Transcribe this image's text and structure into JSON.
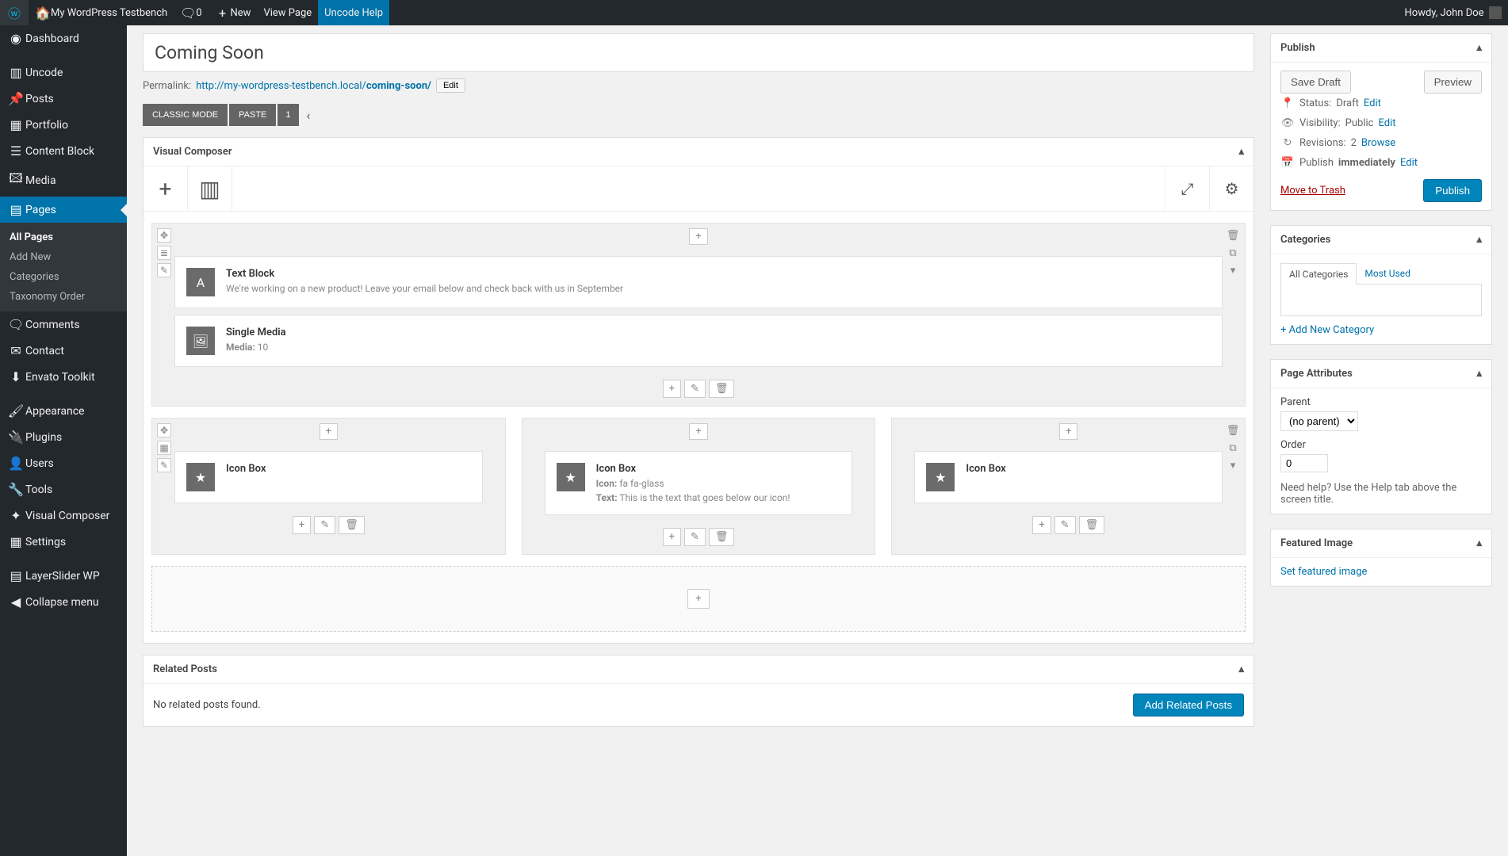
{
  "adminbar": {
    "site_name": "My WordPress Testbench",
    "comments_count": "0",
    "new_label": "New",
    "view_page": "View Page",
    "uncode_help": "Uncode Help",
    "howdy": "Howdy, John Doe"
  },
  "sidebar": {
    "items": [
      {
        "label": "Dashboard",
        "icon": "◐"
      },
      {
        "label": "Uncode",
        "icon": "▥"
      },
      {
        "label": "Posts",
        "icon": "✎"
      },
      {
        "label": "Portfolio",
        "icon": "▦"
      },
      {
        "label": "Content Block",
        "icon": "☰"
      },
      {
        "label": "Media",
        "icon": "🖾"
      },
      {
        "label": "Pages",
        "icon": "▤",
        "current": true
      },
      {
        "label": "Comments",
        "icon": "🗨"
      },
      {
        "label": "Contact",
        "icon": "✉"
      },
      {
        "label": "Envato Toolkit",
        "icon": "⬇"
      },
      {
        "label": "Appearance",
        "icon": "🖌"
      },
      {
        "label": "Plugins",
        "icon": "🔌"
      },
      {
        "label": "Users",
        "icon": "👤"
      },
      {
        "label": "Tools",
        "icon": "🔧"
      },
      {
        "label": "Visual Composer",
        "icon": "✦"
      },
      {
        "label": "Settings",
        "icon": "▦"
      },
      {
        "label": "LayerSlider WP",
        "icon": "▤"
      },
      {
        "label": "Collapse menu",
        "icon": "◀"
      }
    ],
    "pages_submenu": [
      "All Pages",
      "Add New",
      "Categories",
      "Taxonomy Order"
    ]
  },
  "page": {
    "title": "Coming Soon",
    "permalink_label": "Permalink:",
    "permalink_base": "http://my-wordpress-testbench.local/",
    "permalink_slug": "coming-soon/",
    "edit_btn": "Edit",
    "classic_mode": "CLASSIC MODE",
    "paste": "PASTE",
    "one": "1"
  },
  "vc": {
    "title": "Visual Composer",
    "text_block": {
      "title": "Text Block",
      "desc": "We're working on a new product! Leave your email below and check back with us in September"
    },
    "single_media": {
      "title": "Single Media",
      "media_label": "Media:",
      "media_val": "10"
    },
    "iconbox1": {
      "title": "Icon Box"
    },
    "iconbox2": {
      "title": "Icon Box",
      "icon_label": "Icon:",
      "icon_val": "fa fa-glass",
      "text_label": "Text:",
      "text_val": "This is the text that goes below our icon!"
    },
    "iconbox3": {
      "title": "Icon Box"
    }
  },
  "related": {
    "title": "Related Posts",
    "none": "No related posts found.",
    "add_btn": "Add Related Posts"
  },
  "publish": {
    "title": "Publish",
    "save_draft": "Save Draft",
    "preview": "Preview",
    "status_label": "Status:",
    "status_val": "Draft",
    "status_edit": "Edit",
    "vis_label": "Visibility:",
    "vis_val": "Public",
    "vis_edit": "Edit",
    "rev_label": "Revisions:",
    "rev_val": "2",
    "rev_browse": "Browse",
    "pub_label": "Publish",
    "pub_val": "immediately",
    "pub_edit": "Edit",
    "trash": "Move to Trash",
    "publish_btn": "Publish"
  },
  "categories": {
    "title": "Categories",
    "tab_all": "All Categories",
    "tab_most": "Most Used",
    "add_new": "+ Add New Category"
  },
  "attrs": {
    "title": "Page Attributes",
    "parent_label": "Parent",
    "parent_val": "(no parent)",
    "order_label": "Order",
    "order_val": "0",
    "help": "Need help? Use the Help tab above the screen title."
  },
  "featured": {
    "title": "Featured Image",
    "set": "Set featured image"
  }
}
